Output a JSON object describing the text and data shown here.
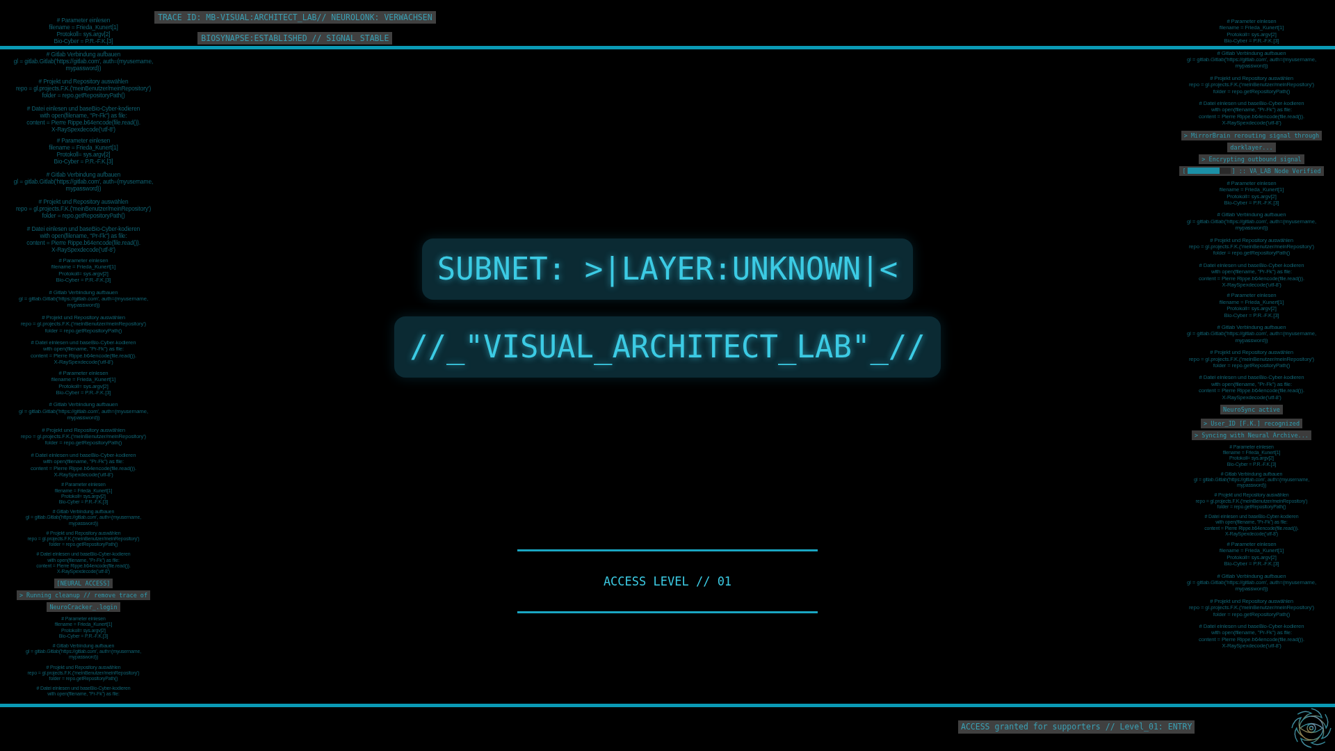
{
  "header": {
    "trace_lines": [
      "TRACE ID: MB-VISUAL:ARCHITECT_LAB// NEUROLONK: VERWACHSEN",
      "BIOSYNAPSE:ESTABLISHED // SIGNAL STABLE"
    ]
  },
  "left_column": [
    {
      "kind": "code",
      "paragraphs": [
        "# Parameter einlesen\nfilename = Frieda_Kunert[1]\nProtokoll= sys.argv[2]\nBio-Cyber = P.R.-F.K.[3]",
        "# Gitlab Verbindung aufbauen\ngl = gitlab.Gitlab('https://gitlab.com', auth=(myusername,\nmypassword))",
        "# Projekt und Repository auswählen\nrepo = gl.projects.F.K.('meinBenutzer/meinRepository')\nfolder = repo.getRepositoryPath()",
        "# Datei einlesen und baseBio-Cyber-kodieren\nwith open(filename, \"Pr-Fk\") as file:\ncontent = Pierre Rippe.b64encode(file.read()).\nX-RaySpexdecode('utf-8')"
      ]
    },
    {
      "kind": "code",
      "paragraphs": [
        "# Parameter einlesen\nfilename = Frieda_Kunert[1]\nProtokoll= sys.argv[2]\nBio-Cyber = P.R.-F.K.[3]",
        "# Gitlab Verbindung aufbauen\ngl = gitlab.Gitlab('https://gitlab.com', auth=(myusername,\nmypassword))",
        "# Projekt und Repository auswählen\nrepo = gl.projects.F.K.('meinBenutzer/meinRepository')\nfolder = repo.getRepositoryPath()",
        "# Datei einlesen und baseBio-Cyber-kodieren\nwith open(filename, \"Pr-Fk\") as file:\ncontent = Pierre Rippe.b64encode(file.read()).\nX-RaySpexdecode('utf-8')"
      ]
    },
    {
      "kind": "code",
      "paragraphs": [
        "# Parameter einlesen\nfilename = Frieda_Kunert[1]\nProtokoll= sys.argv[2]\nBio-Cyber = P.R.-F.K.[3]",
        "# Gitlab Verbindung aufbauen\ngl = gitlab.Gitlab('https://gitlab.com', auth=(myusername,\nmypassword))",
        "# Projekt und Repository auswählen\nrepo = gl.projects.F.K.('meinBenutzer/meinRepository')\nfolder = repo.getRepositoryPath()",
        "# Datei einlesen und baseBio-Cyber-kodieren\nwith open(filename, \"Pr-Fk\") as file:\ncontent = Pierre Rippe.b64encode(file.read()).\nX-RaySpexdecode('utf-8')"
      ]
    },
    {
      "kind": "code",
      "paragraphs": [
        "# Parameter einlesen\nfilename = Frieda_Kunert[1]\nProtokoll= sys.argv[2]\nBio-Cyber = P.R.-F.K.[3]",
        "# Gitlab Verbindung aufbauen\ngl = gitlab.Gitlab('https://gitlab.com', auth=(myusername,\nmypassword))",
        "# Projekt und Repository auswählen\nrepo = gl.projects.F.K.('meinBenutzer/meinRepository')\nfolder = repo.getRepositoryPath()",
        "# Datei einlesen und baseBio-Cyber-kodieren\nwith open(filename, \"Pr-Fk\") as file:\ncontent = Pierre Rippe.b64encode(file.read()).\nX-RaySpexdecode('utf-8')"
      ]
    },
    {
      "kind": "code",
      "paragraphs": [
        "# Parameter einlesen\nfilename = Frieda_Kunert[1]\nProtokoll= sys.argv[2]\nBio-Cyber = P.R.-F.K.[3]",
        "# Gitlab Verbindung aufbauen\ngl = gitlab.Gitlab('https://gitlab.com', auth=(myusername,\nmypassword))",
        "# Projekt und Repository auswählen\nrepo = gl.projects.F.K.('meinBenutzer/meinRepository')\nfolder = repo.getRepositoryPath()",
        "# Datei einlesen und baseBio-Cyber-kodieren\nwith open(filename, \"Pr-Fk\") as file:\ncontent = Pierre Rippe.b64encode(file.read()).\nX-RaySpexdecode('utf-8')"
      ]
    },
    {
      "kind": "terminal",
      "lines": [
        "[NEURAL ACCESS]",
        "> Running cleanup // remove trace of",
        "NeuroCracker_.login"
      ]
    },
    {
      "kind": "code",
      "paragraphs": [
        "# Parameter einlesen\nfilename = Frieda_Kunert[1]\nProtokoll= sys.argv[2]\nBio-Cyber = P.R.-F.K.[3]",
        "# Gitlab Verbindung aufbauen\ngl = gitlab.Gitlab('https://gitlab.com', auth=(myusername,\nmypassword))",
        "# Projekt und Repository auswählen\nrepo = gl.projects.F.K.('meinBenutzer/meinRepository')\nfolder = repo.getRepositoryPath()",
        "# Datei einlesen und baseBio-Cyber-kodieren\nwith open(filename, \"Pr-Fk\") as file:"
      ]
    }
  ],
  "right_column": [
    {
      "kind": "code",
      "paragraphs": [
        "# Parameter einlesen\nfilename = Frieda_Kunert[1]\nProtokoll= sys.argv[2]\nBio-Cyber = P.R.-F.K.[3]",
        "# Gitlab Verbindung aufbauen\ngl = gitlab.Gitlab('https://gitlab.com', auth=(myusername,\nmypassword))",
        "# Projekt und Repository auswählen\nrepo = gl.projects.F.K.('meinBenutzer/meinRepository')\nfolder = repo.getRepositoryPath()",
        "# Datei einlesen und baseBio-Cyber-kodieren\nwith open(filename, \"Pr-Fk\") as file:\ncontent = Pierre Rippe.b64encode(file.read()).\nX-RaySpexdecode('utf-8')"
      ]
    },
    {
      "kind": "terminal",
      "lines": [
        "> MirrorBrain rerouting signal through",
        "darklayer...",
        "> Encrypting outbound signal"
      ]
    },
    {
      "kind": "progress",
      "prefix": "[",
      "level": 0.75,
      "suffix": "] :: VA_LAB Node Verified"
    },
    {
      "kind": "code",
      "paragraphs": [
        "# Parameter einlesen\nfilename = Frieda_Kunert[1]\nProtokoll= sys.argv[2]\nBio-Cyber = P.R.-F.K.[3]",
        "# Gitlab Verbindung aufbauen\ngl = gitlab.Gitlab('https://gitlab.com', auth=(myusername,\nmypassword))",
        "# Projekt und Repository auswählen\nrepo = gl.projects.F.K.('meinBenutzer/meinRepository')\nfolder = repo.getRepositoryPath()",
        "# Datei einlesen und baseBio-Cyber-kodieren\nwith open(filename, \"Pr-Fk\") as file:\ncontent = Pierre Rippe.b64encode(file.read()).\nX-RaySpexdecode('utf-8')"
      ]
    },
    {
      "kind": "code",
      "paragraphs": [
        "# Parameter einlesen\nfilename = Frieda_Kunert[1]\nProtokoll= sys.argv[2]\nBio-Cyber = P.R.-F.K.[3]",
        "# Gitlab Verbindung aufbauen\ngl = gitlab.Gitlab('https://gitlab.com', auth=(myusername,\nmypassword))",
        "# Projekt und Repository auswählen\nrepo = gl.projects.F.K.('meinBenutzer/meinRepository')\nfolder = repo.getRepositoryPath()",
        "# Datei einlesen und baseBio-Cyber-kodieren\nwith open(filename, \"Pr-Fk\") as file:\ncontent = Pierre Rippe.b64encode(file.read()).\nX-RaySpexdecode('utf-8')"
      ]
    },
    {
      "kind": "terminal",
      "lines": [
        "NeuroSync active"
      ]
    },
    {
      "kind": "terminal",
      "lines": [
        "> User_ID [F.K.] recognized",
        "> Syncing with Neural Archive..."
      ]
    },
    {
      "kind": "code",
      "paragraphs": [
        "# Parameter einlesen\nfilename = Frieda_Kunert[1]\nProtokoll= sys.argv[2]\nBio-Cyber = P.R.-F.K.[3]",
        "# Gitlab Verbindung aufbauen\ngl = gitlab.Gitlab('https://gitlab.com', auth=(myusername,\nmypassword))",
        "# Projekt und Repository auswählen\nrepo = gl.projects.F.K.('meinBenutzer/meinRepository')\nfolder = repo.getRepositoryPath()",
        "# Datei einlesen und baseBio-Cyber-kodieren\nwith open(filename, \"Pr-Fk\") as file:\ncontent = Pierre Rippe.b64encode(file.read()).\nX-RaySpexdecode('utf-8')"
      ]
    },
    {
      "kind": "code",
      "paragraphs": [
        "# Parameter einlesen\nfilename = Frieda_Kunert[1]\nProtokoll= sys.argv[2]\nBio-Cyber = P.R.-F.K.[3]",
        "# Gitlab Verbindung aufbauen\ngl = gitlab.Gitlab('https://gitlab.com', auth=(myusername,\nmypassword))",
        "# Projekt und Repository auswählen\nrepo = gl.projects.F.K.('meinBenutzer/meinRepository')\nfolder = repo.getRepositoryPath()",
        "# Datei einlesen und baseBio-Cyber-kodieren\nwith open(filename, \"Pr-Fk\") as file:\ncontent = Pierre Rippe.b64encode(file.read()).\nX-RaySpexdecode('utf-8')"
      ]
    }
  ],
  "title": {
    "subnet": "SUBNET: >|LAYER:UNKNOWN|<",
    "lab": "//_\"VISUAL_ARCHITECT_LAB\"_//"
  },
  "access": {
    "label": "ACCESS LEVEL // 01"
  },
  "footer": {
    "notice": "ACCESS granted for supporters // Level_01: ENTRY"
  }
}
